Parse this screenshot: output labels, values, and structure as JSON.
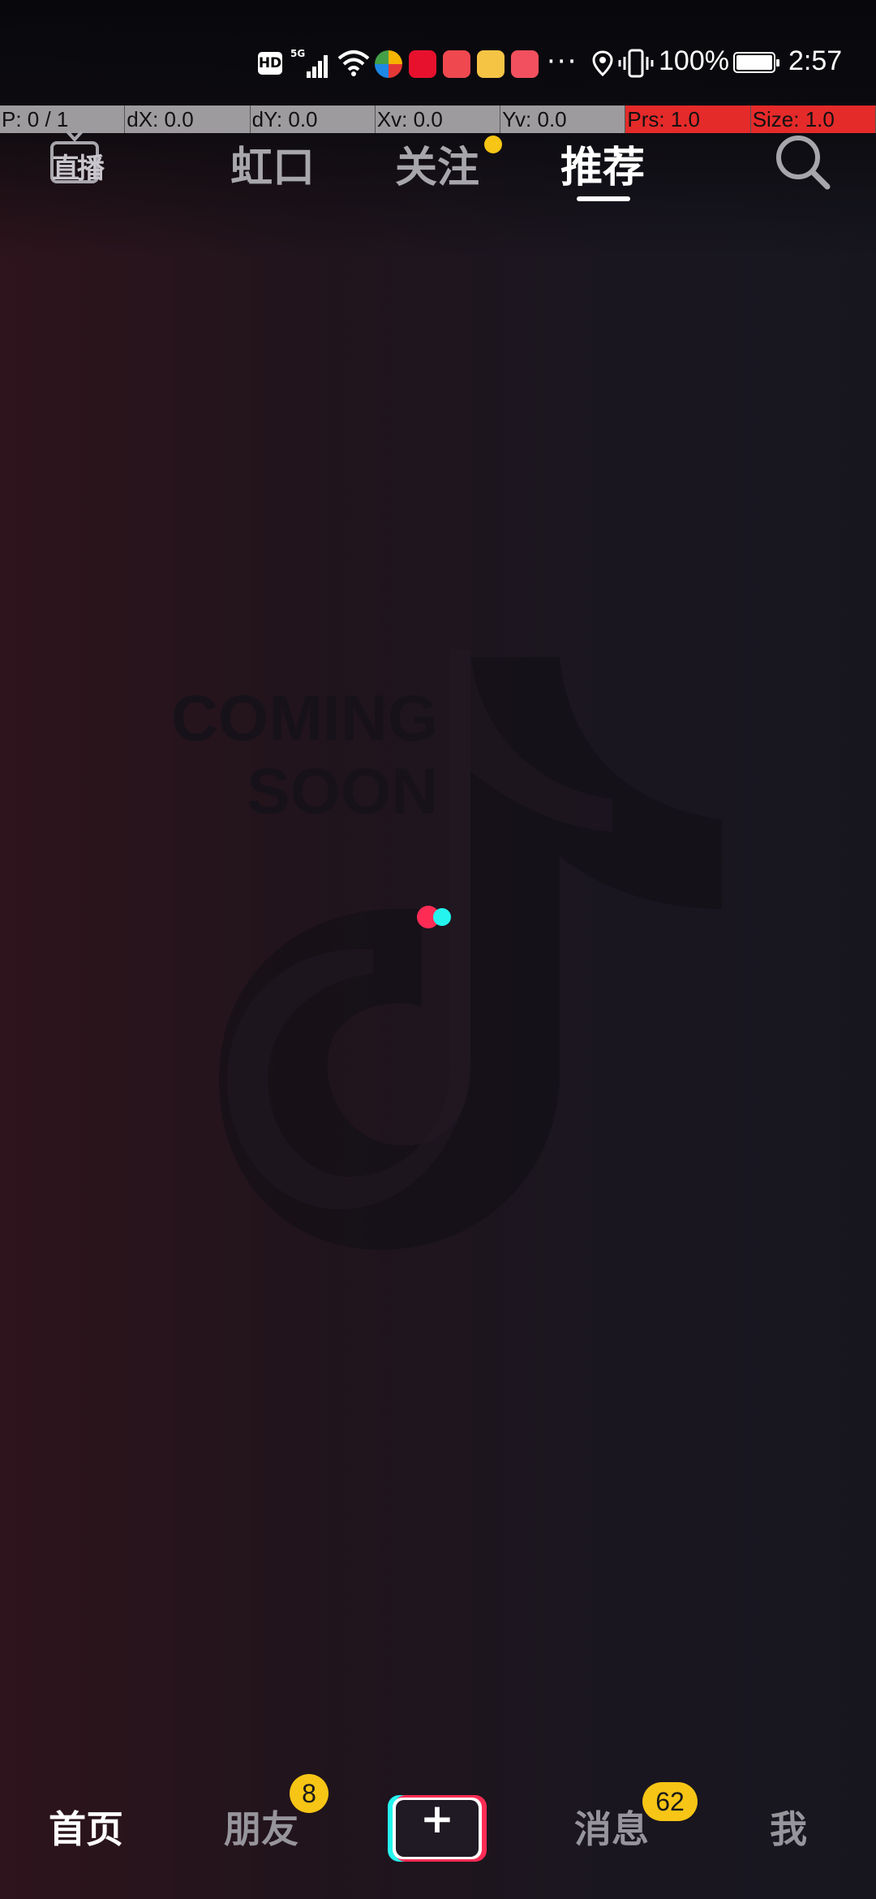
{
  "status_bar": {
    "hd_label": "HD",
    "network_label": "5G",
    "battery_percent": "100%",
    "time": "2:57",
    "icons": [
      "hd-icon",
      "signal-icon",
      "wifi-icon",
      "browser-app-icon",
      "jd-app-icon",
      "huawei-store-icon",
      "app-notification-icon",
      "reader-app-icon",
      "more-icon",
      "location-icon",
      "vibrate-icon",
      "battery-charging-icon"
    ],
    "more_label": "···"
  },
  "debug_overlay": {
    "pointer": "P: 0 / 1",
    "dx": "dX: 0.0",
    "dy": "dY: 0.0",
    "xv": "Xv: 0.0",
    "yv": "Yv: 0.0",
    "prs": "Prs: 1.0",
    "size": "Size: 1.0"
  },
  "top_nav": {
    "live_label": "直播",
    "tabs": [
      {
        "label": "虹口",
        "active": false
      },
      {
        "label": "关注",
        "active": false,
        "has_dot": true
      },
      {
        "label": "推荐",
        "active": true
      }
    ],
    "search_icon": "search-icon"
  },
  "placeholder": {
    "line1": "COMING",
    "line2": "SOON"
  },
  "bottom_nav": {
    "tabs": [
      {
        "label": "首页",
        "active": true
      },
      {
        "label": "朋友",
        "badge": "8"
      },
      {
        "label": "消息",
        "badge": "62"
      },
      {
        "label": "我"
      }
    ],
    "create_label": "+"
  },
  "colors": {
    "accent_pink": "#fe2c55",
    "accent_cyan": "#25f4ee",
    "badge_yellow": "#f7c515"
  }
}
